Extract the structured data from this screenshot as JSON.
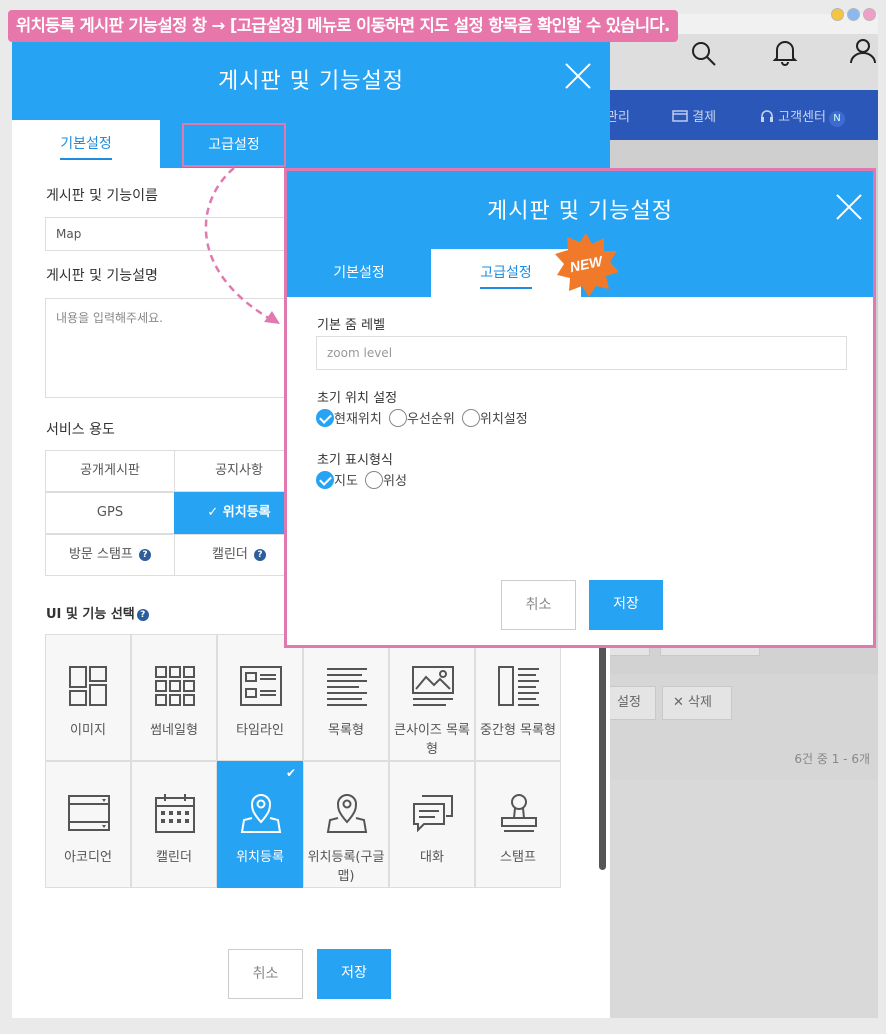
{
  "caption": "위치등록 게시판  기능설정 창 → [고급설정] 메뉴로 이동하면 지도 설정 항목을 확인할 수 있습니다.",
  "window_dots": [
    "#f5c542",
    "#8ab9f1",
    "#f0a0c6"
  ],
  "background": {
    "nav": [
      "관리",
      "결제",
      "고객센터"
    ],
    "nav_badge": "N",
    "buttons": [
      "설정",
      "삭제"
    ],
    "count": "6건 중 1 - 6개"
  },
  "modal_left": {
    "title": "게시판 및 기능설정",
    "tabs": [
      "기본설정",
      "고급설정"
    ],
    "name_label": "게시판 및 기능이름",
    "name_value": "Map",
    "desc_label": "게시판 및 기능설명",
    "desc_placeholder": "내용을 입력해주세요.",
    "usage_label": "서비스 용도",
    "usage_options": [
      "공개게시판",
      "공지사항",
      "GPS",
      "✓ 위치등록",
      "방문 스탬프",
      "캘린더"
    ],
    "ui_label": "UI 및 기능 선택",
    "ui_options": [
      "이미지",
      "썸네일형",
      "타임라인",
      "목록형",
      "큰사이즈 목록형",
      "중간형 목록형",
      "아코디언",
      "캘린더",
      "위치등록",
      "위치등록(구글맵)",
      "대화",
      "스탬프"
    ],
    "ui_selected": "위치등록",
    "cancel": "취소",
    "save": "저장"
  },
  "modal_right": {
    "title": "게시판 및 기능설정",
    "tabs": [
      "기본설정",
      "고급설정"
    ],
    "new_badge": "NEW",
    "zoom_label": "기본 줌 레벨",
    "zoom_placeholder": "zoom level",
    "init_loc_label": "초기 위치 설정",
    "init_loc_options": [
      "현재위치",
      "우선순위",
      "위치설정"
    ],
    "init_loc_selected": "현재위치",
    "display_label": "초기 표시형식",
    "display_options": [
      "지도",
      "위성"
    ],
    "display_selected": "지도",
    "cancel": "취소",
    "save": "저장"
  },
  "colors": {
    "primary": "#27a3f4",
    "highlight": "#e079b0",
    "badge": "#f07a2a",
    "nav": "#2a57b8"
  }
}
